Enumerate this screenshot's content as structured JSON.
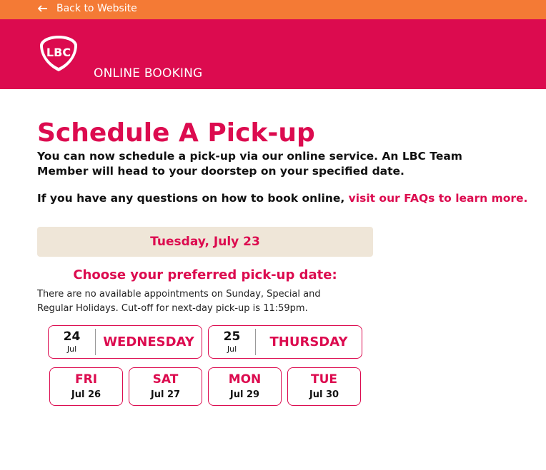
{
  "topbar": {
    "back_label": "Back to Website",
    "color": "#f47a35"
  },
  "header": {
    "logo_text": "LBC",
    "title": "ONLINE BOOKING",
    "color": "#dc0b4f"
  },
  "main": {
    "title": "Schedule A Pick-up",
    "intro": "You can now schedule a pick-up via our online service. An LBC Team Member will head to your doorstep on your specified date.",
    "faq_prefix": "If you have any questions on how to book online, ",
    "faq_link": "visit our FAQs to learn more.",
    "selected_date": "Tuesday, July 23",
    "choose_title": "Choose your preferred pick-up date:",
    "notice": "There are no available appointments on Sunday, Special and Regular Holidays. Cut-off for next-day pick-up is 11:59pm."
  },
  "date_options_large": [
    {
      "day": "24",
      "month": "Jul",
      "weekday": "WEDNESDAY"
    },
    {
      "day": "25",
      "month": "Jul",
      "weekday": "THURSDAY"
    }
  ],
  "date_options_small": [
    {
      "weekday": "FRI",
      "date": "Jul 26"
    },
    {
      "weekday": "SAT",
      "date": "Jul 27"
    },
    {
      "weekday": "MON",
      "date": "Jul 29"
    },
    {
      "weekday": "TUE",
      "date": "Jul 30"
    }
  ]
}
